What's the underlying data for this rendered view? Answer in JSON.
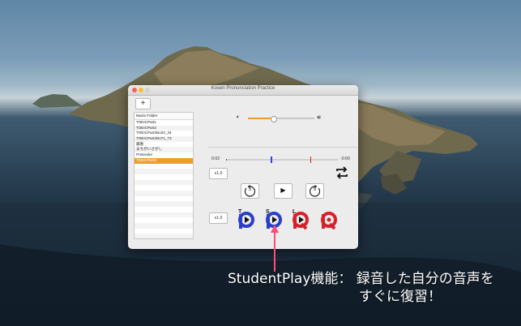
{
  "window": {
    "title": "Kosen Pronunciation Practice",
    "add_label": "+"
  },
  "sidebar": {
    "header": "Music Folder",
    "items": [
      {
        "label": "TOEICPart1",
        "selected": false
      },
      {
        "label": "TOEICPart2",
        "selected": false
      },
      {
        "label": "TOEICPart3No32_34",
        "selected": false
      },
      {
        "label": "TOEICPart4No71_73",
        "selected": false
      },
      {
        "label": "蔵春",
        "selected": false
      },
      {
        "label": "まちがいさがし",
        "selected": false
      },
      {
        "label": "Pretender",
        "selected": false
      },
      {
        "label": "TOEICPart5",
        "selected": true
      }
    ]
  },
  "volume": {
    "level": 0.38,
    "low_icon": "speaker-low-icon",
    "high_icon": "speaker-high-icon"
  },
  "playback": {
    "time_current": "0:02",
    "time_remaining": "-0:00",
    "progress": 0.01,
    "marker_a": 0.4,
    "marker_b": 0.75,
    "speed_label_1": "x1.0",
    "speed_label_2": "x1.0",
    "repeat_icon": "repeat-icon",
    "rewind_label": "5",
    "forward_label": "5",
    "play_symbol": "▶"
  },
  "modes": {
    "teacher_letter": "T",
    "student_letter": "S",
    "loop_letter": "L"
  },
  "colors": {
    "accent": "#e9a02b",
    "mode_blue": "#2a3fc9",
    "mode_red": "#d8202a",
    "arrow": "#ff4d7a"
  },
  "caption": {
    "line1": "StudentPlay機能： 録音した自分の音声を",
    "line2": "すぐに復習！"
  }
}
